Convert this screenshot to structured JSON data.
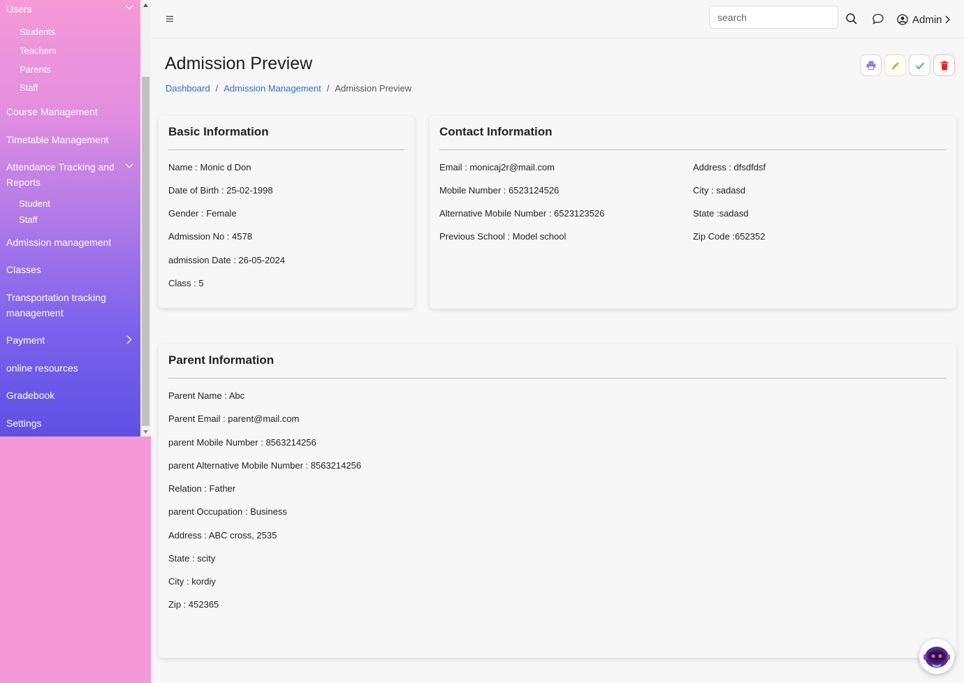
{
  "sidebar": {
    "users": "Users",
    "users_sub": [
      "Students",
      "Teachers",
      "Parents",
      "Staff"
    ],
    "course": "Course Management",
    "timetable": "Timetable Management",
    "attendance_line1": "Attendance Tracking and",
    "attendance_line2": "Reports",
    "attendance_sub": [
      "Student",
      "Staff"
    ],
    "admission": "Admission management",
    "classes": "Classes",
    "transport_line1": "Transportation tracking",
    "transport_line2": "management",
    "payment": "Payment",
    "online": "online resources",
    "gradebook": "Gradebook",
    "settings": "Settings"
  },
  "topbar": {
    "search_placeholder": "search",
    "admin_label": "Admin"
  },
  "header": {
    "title": "Admission Preview",
    "breadcrumb": [
      "Dashboard",
      "Admission Management",
      "Admission Preview"
    ]
  },
  "basic": {
    "title": "Basic Information",
    "fields": [
      "Name : Monic d Don",
      "Date of Birth : 25-02-1998",
      "Gender : Female",
      "Admission No : 4578",
      "admission Date : 26-05-2024",
      "Class : 5"
    ]
  },
  "contact": {
    "title": "Contact Information",
    "left": [
      "Email : monicaj2r@mail.com",
      "Mobile Number : 6523124526",
      "Alternative Mobile Number : 6523123526",
      "Previous School : Model school"
    ],
    "right": [
      "Address : dfsdfdsf",
      "City : sadasd",
      "State :sadasd",
      "Zip Code :652352"
    ]
  },
  "parent": {
    "title": "Parent Information",
    "fields": [
      "Parent Name : Abc",
      "Parent Email : parent@mail.com",
      "parent Mobile Number : 8563214256",
      "parent Alternative Mobile Number : 8563214256",
      "Relation : Father",
      "parent Occupation : Business",
      "Address : ABC cross, 2535",
      "State : scity",
      "City : kordiy",
      "Zip : 452365"
    ]
  },
  "colors": {
    "link": "#2a6fd6",
    "print": "#8a7be8",
    "edit": "#f0a81c",
    "approve": "#2fb85a",
    "delete": "#e02424"
  },
  "icons": [
    "menu-icon",
    "search-icon",
    "chat-icon",
    "user-circle-icon",
    "chevron-right-icon",
    "print-icon",
    "pencil-icon",
    "check-icon",
    "trash-icon",
    "chatbot-icon"
  ]
}
